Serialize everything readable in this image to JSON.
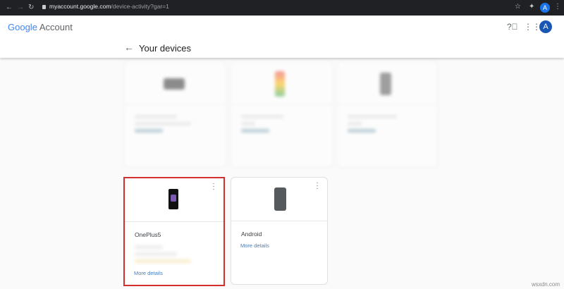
{
  "browser": {
    "url_host": "myaccount.google.com",
    "url_path": "/device-activity?gar=1",
    "profile_initial": "A"
  },
  "header": {
    "logo_google": "Google",
    "logo_account": "Account",
    "profile_initial": "A",
    "page_title": "Your devices"
  },
  "devices": [
    {
      "name": "OnePlus5",
      "more_details": "More details",
      "highlighted": true
    },
    {
      "name": "Android",
      "more_details": "More details",
      "highlighted": false
    }
  ],
  "colors": {
    "highlight": "#d32f2f",
    "link": "#4a7ebb"
  },
  "watermark": "wsxdn.com"
}
